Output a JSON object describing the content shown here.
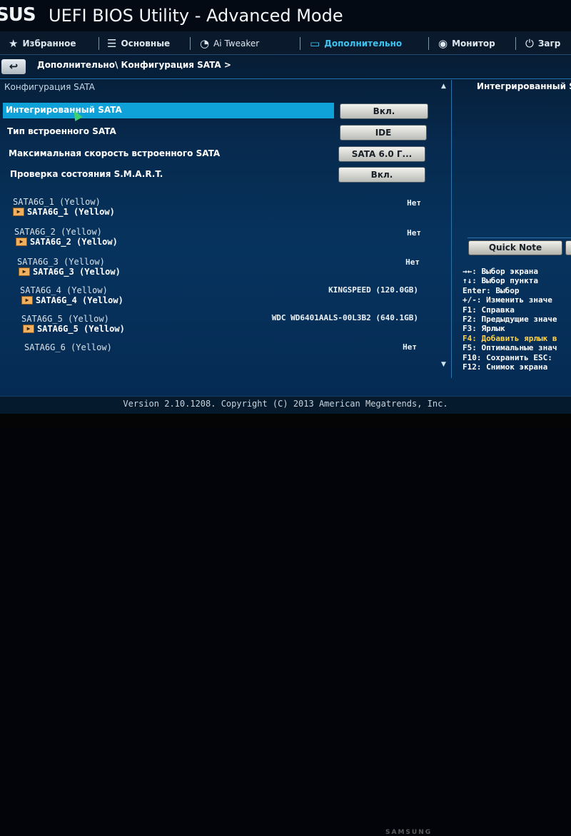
{
  "app": {
    "logo": "SUS",
    "title": "UEFI BIOS Utility - Advanced Mode"
  },
  "tabs": [
    {
      "icon": "★",
      "label": "Избранное"
    },
    {
      "icon": "☰",
      "label": "Основные"
    },
    {
      "icon": "◔",
      "label": "Ai Tweaker"
    },
    {
      "icon": "▭",
      "label": "Дополнительно"
    },
    {
      "icon": "◉",
      "label": "Монитор"
    },
    {
      "icon": "⏻",
      "label": "Загр"
    }
  ],
  "active_tab": "Дополнительно",
  "breadcrumb": {
    "back": "↩",
    "path": "Дополнительно\\ Конфигурация SATA >"
  },
  "section_title": "Конфигурация SATA",
  "settings": [
    {
      "label": "Интегрированный SATA",
      "value": "Вкл."
    },
    {
      "label": "Тип встроенного SATA",
      "value": "IDE"
    },
    {
      "label": "Максимальная скорость встроенного SATA",
      "value": "SATA 6.0 Г..."
    },
    {
      "label": "Проверка состояния S.M.A.R.T.",
      "value": "Вкл."
    }
  ],
  "ports": [
    {
      "name": "SATA6G_1 (Yellow)",
      "device": "SATA6G_1 (Yellow)",
      "value": "Нет"
    },
    {
      "name": "SATA6G_2 (Yellow)",
      "device": "SATA6G_2 (Yellow)",
      "value": "Нет"
    },
    {
      "name": "SATA6G_3 (Yellow)",
      "device": "SATA6G_3 (Yellow)",
      "value": "Нет"
    },
    {
      "name": "SATA6G_4 (Yellow)",
      "device": "SATA6G_4 (Yellow)",
      "value": "KINGSPEED (120.0GB)"
    },
    {
      "name": "SATA6G_5 (Yellow)",
      "device": "SATA6G_5 (Yellow)",
      "value": "WDC WD6401AALS-00L3B2 (640.1GB)"
    },
    {
      "name": "SATA6G_6 (Yellow)",
      "device": "",
      "value": "Нет"
    }
  ],
  "help": {
    "title": "Интегрированный S",
    "quick_note": "Quick Note",
    "keys": [
      "→←: Выбор экрана",
      "↑↓: Выбор пункта",
      "Enter: Выбор",
      "+/-: Изменить значе",
      "F1: Справка",
      "F2: Предыдущие значе",
      "F3: Ярлык",
      "F4: Добавить ярлык в",
      "F5: Оптимальные знач",
      "F10: Сохранить ESC:",
      "F12: Снимок экрана"
    ]
  },
  "footer": {
    "version": "Version 2.10.1208. Copyright (C) 2013 American Megatrends, Inc."
  },
  "monitor_brand": "SAMSUNG",
  "colors": {
    "highlight": "#0fa2d9",
    "active_tab": "#3ec4f2",
    "accent_key": "#ffd24a",
    "background": "#06335e"
  }
}
